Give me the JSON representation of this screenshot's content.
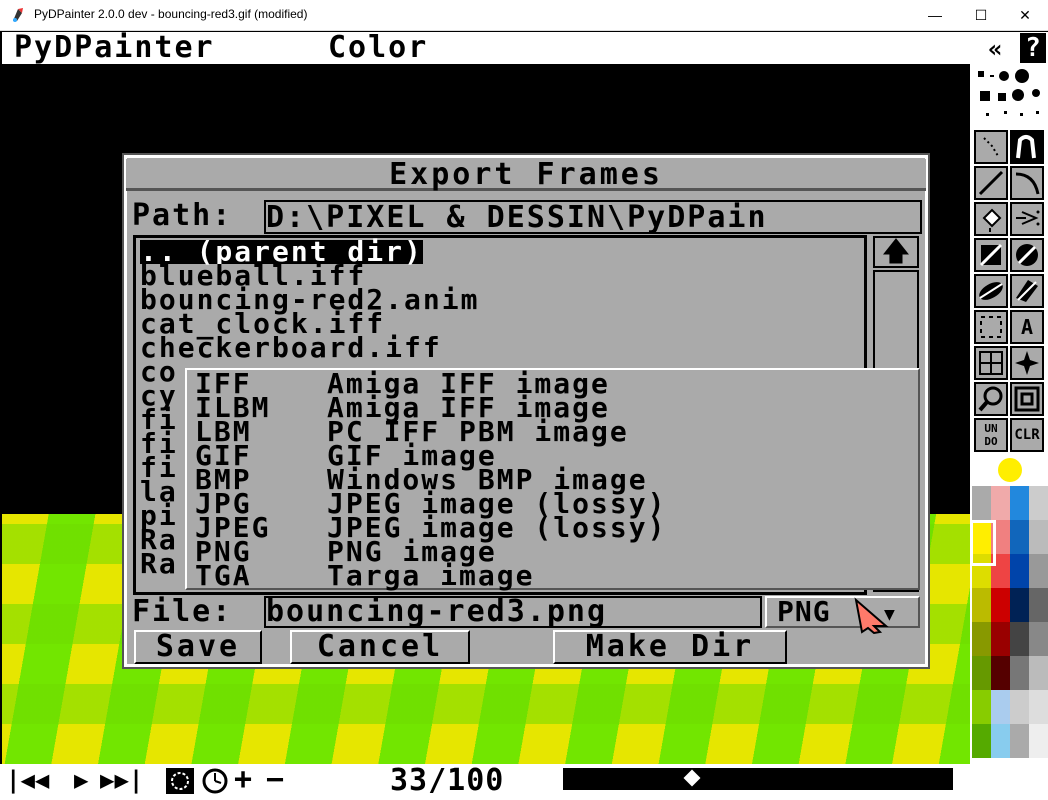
{
  "window": {
    "title": "PyDPainter 2.0.0 dev - bouncing-red3.gif (modified)",
    "minimize": "—",
    "maximize": "☐",
    "close": "✕"
  },
  "menubar": {
    "items": [
      "PyDPainter",
      "Color"
    ],
    "back_label": "«",
    "help_label": "?"
  },
  "dialog": {
    "title": "Export Frames",
    "path_label": "Path:",
    "path_value": "D:\\PIXEL & DESSIN\\PyDPain",
    "files": [
      ".. (parent dir)",
      "blueball.iff",
      "bouncing-red2.anim",
      "cat_clock.iff",
      "checkerboard.iff",
      "co",
      "cy",
      "fi",
      "fi",
      "fi",
      "la",
      "pi",
      "Ra",
      "Ra"
    ],
    "scroll_up": "🡅",
    "file_label": "File:",
    "file_value": "bouncing-red3.png",
    "format_selected": "PNG",
    "formats": [
      {
        "ext": "IFF",
        "desc": "Amiga IFF image"
      },
      {
        "ext": "ILBM",
        "desc": "Amiga IFF image"
      },
      {
        "ext": "LBM",
        "desc": "PC IFF PBM image"
      },
      {
        "ext": "GIF",
        "desc": "GIF image"
      },
      {
        "ext": "BMP",
        "desc": "Windows BMP image"
      },
      {
        "ext": "JPG",
        "desc": "JPEG image (lossy)"
      },
      {
        "ext": "JPEG",
        "desc": "JPEG image (lossy)"
      },
      {
        "ext": "PNG",
        "desc": "PNG image"
      },
      {
        "ext": "TGA",
        "desc": "Targa image"
      }
    ],
    "buttons": {
      "save": "Save",
      "cancel": "Cancel",
      "make_dir": "Make Dir"
    }
  },
  "timeline": {
    "frame_current": 33,
    "frame_total": 100,
    "frame_label": "33/100",
    "controls": [
      "|◀◀",
      "▶",
      "▶▶|",
      "+",
      "−"
    ],
    "position_fraction": 0.33
  },
  "toolbox": {
    "tools": [
      "dotted-freehand",
      "continuous-freehand",
      "line",
      "curve",
      "fill",
      "airbrush",
      "rectangle",
      "circle",
      "ellipse",
      "polygon",
      "brush-select",
      "text",
      "grid",
      "symmetry",
      "magnify",
      "zoom",
      "undo",
      "clear"
    ],
    "text_label": "A",
    "undo_label": "UN DO",
    "clear_label": "CLR",
    "fg_color": "#ffee00"
  },
  "palette": [
    "#aaaaaa",
    "#f0aaaa",
    "#2288dd",
    "#cccccc",
    "#ffee00",
    "#f08080",
    "#1166bb",
    "#bbbbbb",
    "#dddd00",
    "#ee4444",
    "#0044aa",
    "#999999",
    "#bbbb00",
    "#cc0000",
    "#002255",
    "#666666",
    "#889900",
    "#990000",
    "#444444",
    "#888888",
    "#669900",
    "#550000",
    "#777777",
    "#bbbbbb",
    "#88cc00",
    "#aaccee",
    "#cccccc",
    "#dddddd",
    "#55aa00",
    "#88ccee",
    "#aaaaaa",
    "#eeeeee"
  ]
}
